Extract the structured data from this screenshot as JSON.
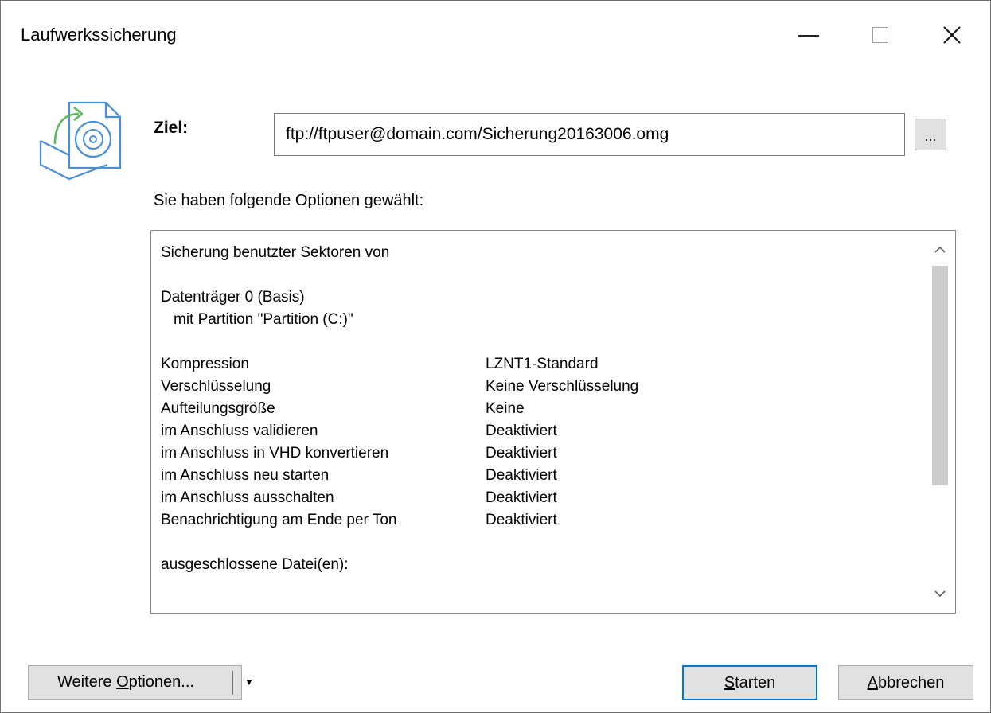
{
  "window": {
    "title": "Laufwerkssicherung"
  },
  "target": {
    "label": "Ziel:",
    "value": "ftp://ftpuser@domain.com/Sicherung20163006.omg",
    "browse_label": "..."
  },
  "options_heading": "Sie haben folgende Optionen gewählt:",
  "summary": {
    "intro": "Sicherung benutzter Sektoren von",
    "disk": "Datenträger 0 (Basis)",
    "partition": "mit Partition \"Partition (C:)\"",
    "settings": [
      {
        "key": "Kompression",
        "value": "LZNT1-Standard"
      },
      {
        "key": "Verschlüsselung",
        "value": "Keine Verschlüsselung"
      },
      {
        "key": "Aufteilungsgröße",
        "value": "Keine"
      },
      {
        "key": "im Anschluss validieren",
        "value": "Deaktiviert"
      },
      {
        "key": "im Anschluss in VHD konvertieren",
        "value": "Deaktiviert"
      },
      {
        "key": "im Anschluss neu starten",
        "value": "Deaktiviert"
      },
      {
        "key": "im Anschluss ausschalten",
        "value": "Deaktiviert"
      },
      {
        "key": "Benachrichtigung am Ende per Ton",
        "value": "Deaktiviert"
      }
    ],
    "excluded_label": "ausgeschlossene Datei(en):"
  },
  "buttons": {
    "more_options_prefix": "Weitere ",
    "more_options_mnemonic": "O",
    "more_options_suffix": "ptionen...",
    "start_mnemonic": "S",
    "start_rest": "tarten",
    "cancel_mnemonic": "A",
    "cancel_rest": "bbrechen"
  },
  "icons": {
    "app": "drive-backup-icon",
    "minimize": "minimize-icon",
    "maximize": "maximize-icon",
    "close": "close-icon",
    "scroll_up": "chevron-up-icon",
    "scroll_down": "chevron-down-icon",
    "dropdown": "caret-down-icon"
  },
  "colors": {
    "accent": "#0078d7",
    "icon_blue": "#4a8fd6",
    "icon_green": "#5cb85c"
  }
}
